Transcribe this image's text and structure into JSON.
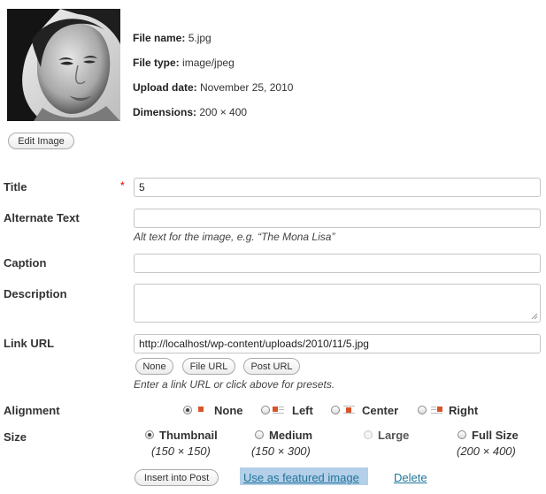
{
  "file_info": {
    "name_label": "File name:",
    "name_value": "5.jpg",
    "type_label": "File type:",
    "type_value": "image/jpeg",
    "date_label": "Upload date:",
    "date_value": "November 25, 2010",
    "dims_label": "Dimensions:",
    "dims_value": "200 × 400"
  },
  "edit_image_button": "Edit Image",
  "fields": {
    "title_label": "Title",
    "required_mark": "*",
    "title_value": "5",
    "alt_label": "Alternate Text",
    "alt_value": "",
    "alt_help": "Alt text for the image, e.g. “The Mona Lisa”",
    "caption_label": "Caption",
    "caption_value": "",
    "description_label": "Description",
    "description_value": "",
    "link_label": "Link URL",
    "link_value": "http://localhost/wp-content/uploads/2010/11/5.jpg",
    "link_help": "Enter a link URL or click above for presets."
  },
  "link_presets": [
    "None",
    "File URL",
    "Post URL"
  ],
  "alignment": {
    "label": "Alignment",
    "options": [
      "None",
      "Left",
      "Center",
      "Right"
    ],
    "selected": "None"
  },
  "size": {
    "label": "Size",
    "options": [
      {
        "name": "Thumbnail",
        "dims": "(150 × 150)"
      },
      {
        "name": "Medium",
        "dims": "(150 × 300)"
      },
      {
        "name": "Large",
        "dims": ""
      },
      {
        "name": "Full Size",
        "dims": "(200 × 400)"
      }
    ],
    "selected": "Thumbnail"
  },
  "actions": {
    "insert": "Insert into Post",
    "featured": "Use as featured image",
    "delete": "Delete"
  },
  "colors": {
    "link": "#21759b",
    "required": "#dd0000",
    "featured_highlight": "#b4cfe8"
  }
}
